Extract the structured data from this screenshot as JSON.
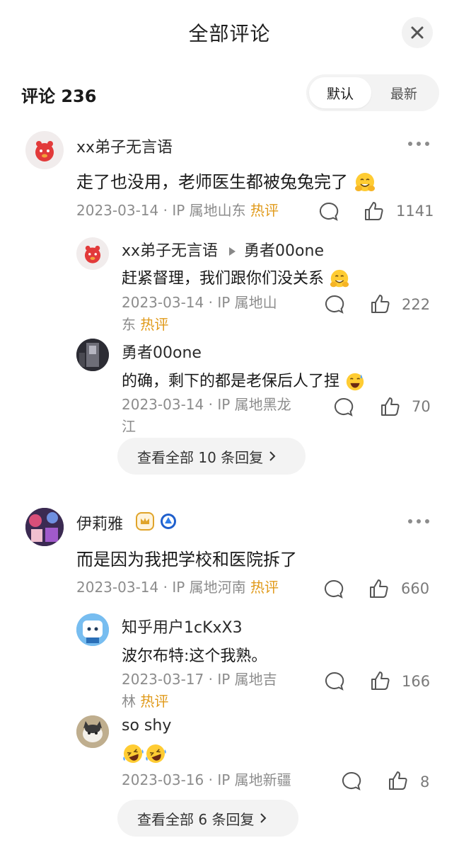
{
  "header": {
    "title": "全部评论"
  },
  "comments_header": {
    "label": "评论",
    "count": "236"
  },
  "sort": {
    "default_label": "默认",
    "latest_label": "最新"
  },
  "threads": [
    {
      "user": "xx弟子无言语",
      "text": "走了也没用，老师医生都被兔兔完了",
      "date": "2023-03-14",
      "sep": "·",
      "ip": "IP 属地山东",
      "hot": "热评",
      "likes": "1141",
      "replies": [
        {
          "user": "xx弟子无言语",
          "reply_to": "勇者00one",
          "text": "赶紧督理，我们跟你们没关系",
          "date": "2023-03-14",
          "sep": "·",
          "ip_line1": "IP 属地山",
          "ip_line2": "东",
          "hot": "热评",
          "likes": "222"
        },
        {
          "user": "勇者00one",
          "text": "的确，剩下的都是老保后人了捏",
          "date": "2023-03-14",
          "sep": "·",
          "ip_line1": "IP 属地黑龙",
          "ip_line2": "江",
          "likes": "70"
        }
      ],
      "view_all": "查看全部 10 条回复"
    },
    {
      "user": "伊莉雅",
      "text": "而是因为我把学校和医院拆了",
      "date": "2023-03-14",
      "sep": "·",
      "ip": "IP 属地河南",
      "hot": "热评",
      "likes": "660",
      "replies": [
        {
          "user": "知乎用户1cKxX3",
          "text": "波尔布特:这个我熟。",
          "date": "2023-03-17",
          "sep": "·",
          "ip_line1": "IP 属地吉",
          "ip_line2": "林",
          "hot": "热评",
          "likes": "166"
        },
        {
          "user": "so shy",
          "date": "2023-03-16",
          "sep": "·",
          "ip": "IP 属地新疆",
          "likes": "8"
        }
      ],
      "view_all": "查看全部 6 条回复"
    }
  ],
  "icons": {
    "close": "close-icon",
    "comment": "comment-bubble-icon",
    "like": "thumbs-up-icon",
    "more": "more-dots-icon",
    "chevron": "chevron-right-icon",
    "emoji_smile": "hugging-face-emoji",
    "emoji_sweat": "grinning-sweat-emoji",
    "emoji_laugh": "rolling-laughing-emoji"
  },
  "colors": {
    "hot": "#e09a1a",
    "meta": "#8c8c8c",
    "pill_bg": "#f3f3f3"
  }
}
